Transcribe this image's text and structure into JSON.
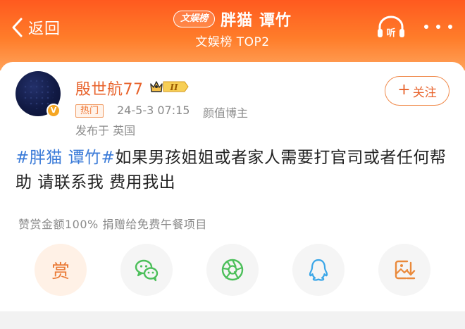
{
  "header": {
    "back_label": "返回",
    "badge": "文娱榜",
    "title": "胖猫 谭竹",
    "subtitle": "文娱榜 TOP2",
    "listen_label": "听",
    "accent_color": "#ff6a24"
  },
  "post": {
    "author": {
      "name": "殷世航77",
      "verified_badge": "V",
      "vip_level": "II"
    },
    "follow_label": "关注",
    "follow_plus": "+",
    "hot_tag": "热门",
    "time": "24-5-3 07:15",
    "role": "颜值博主",
    "location": "发布于 英国",
    "hashtag": "#胖猫 谭竹#",
    "text": "如果男孩姐姐或者家人需要打官司或者任何帮助 请联系我 费用我出",
    "donation_note": "赞赏金额100% 捐赠给免费午餐项目"
  },
  "share": {
    "reward_label": "赏",
    "items": [
      "reward",
      "wechat-icon",
      "moments-icon",
      "qq-icon",
      "save-image-icon"
    ]
  },
  "colors": {
    "hashtag": "#3b7bd8",
    "username": "#e8632c",
    "muted": "#8a8a8a"
  }
}
